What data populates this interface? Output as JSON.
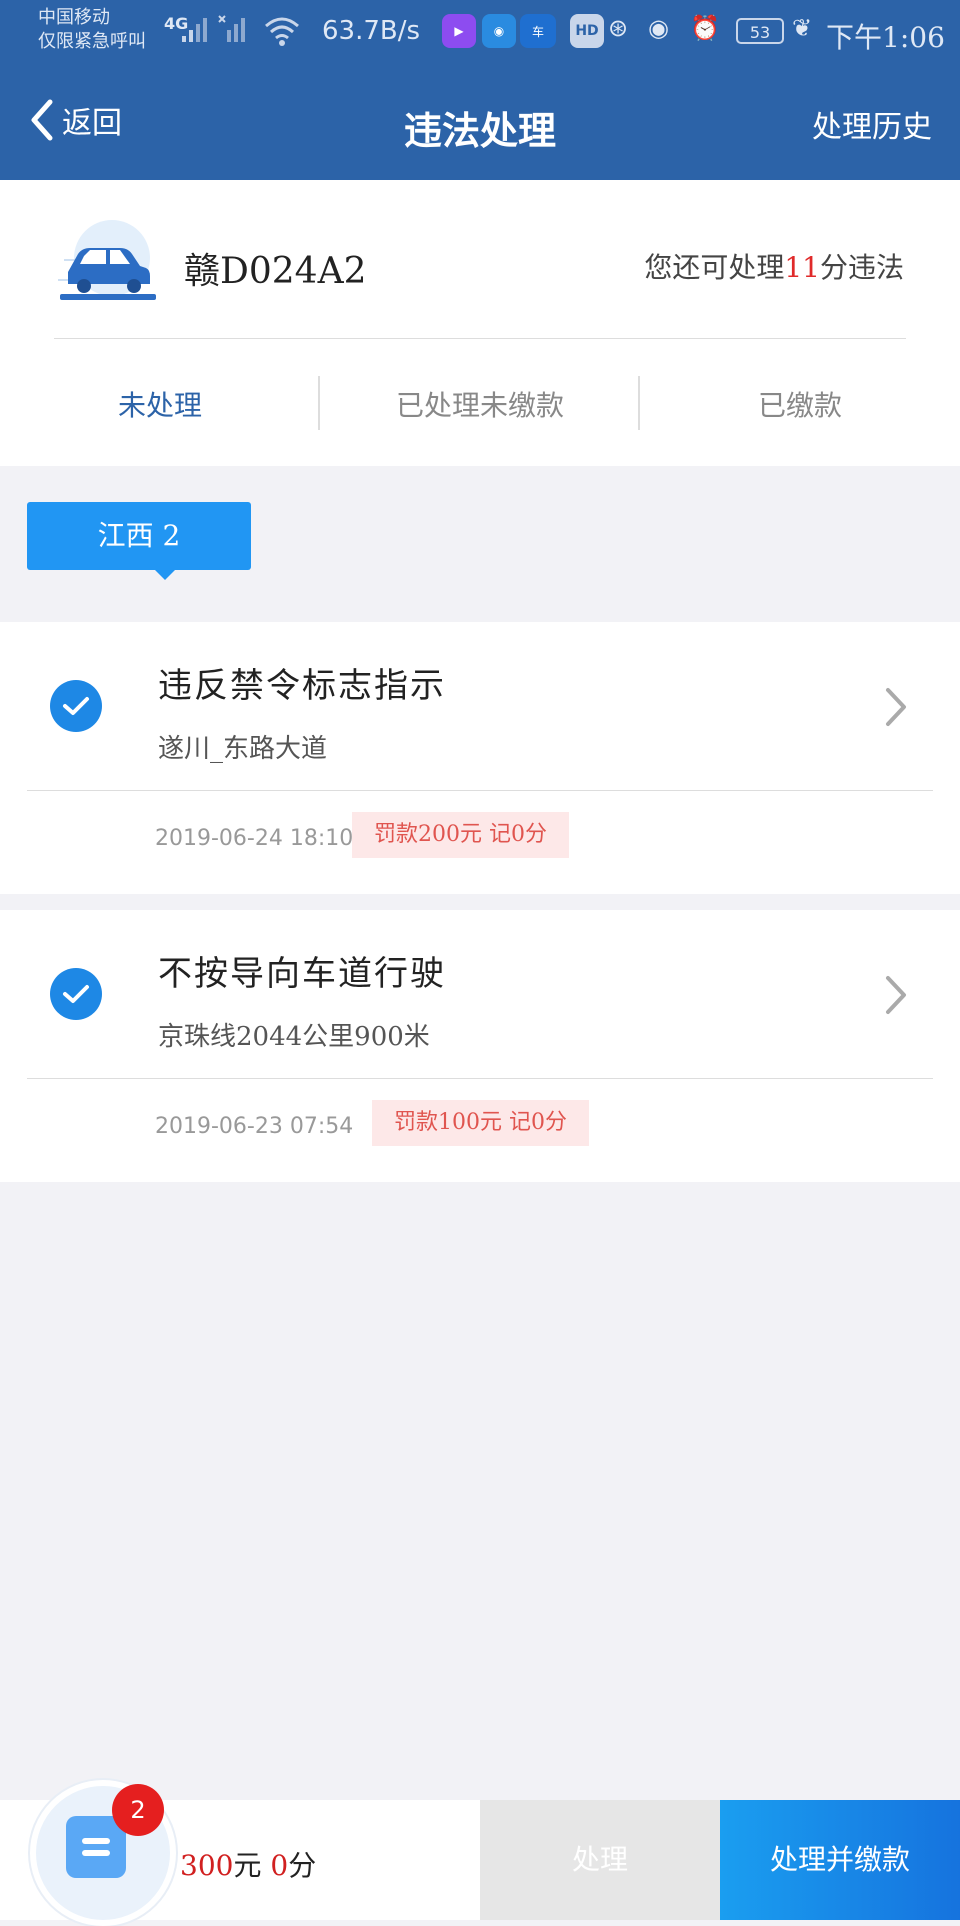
{
  "status_bar": {
    "carrier_line1": "中国移动",
    "carrier_line2": "仅限紧急呼叫",
    "network": "4G",
    "speed": "63.7B/s",
    "hd": "HD",
    "battery": "53",
    "time": "下午1:06"
  },
  "header": {
    "back_label": "返回",
    "title": "违法处理",
    "history_label": "处理历史"
  },
  "vehicle": {
    "plate": "赣D024A2",
    "remaining_prefix": "您还可处理",
    "remaining_count": "11",
    "remaining_suffix": "分违法"
  },
  "tabs": [
    {
      "label": "未处理",
      "active": true
    },
    {
      "label": "已处理未缴款",
      "active": false
    },
    {
      "label": "已缴款",
      "active": false
    }
  ],
  "region": {
    "label": "江西 2"
  },
  "violations": [
    {
      "title": "违反禁令标志指示",
      "location": "遂川_东路大道",
      "datetime": "2019-06-24 18:10",
      "fine": "罚款200元 记0分"
    },
    {
      "title": "不按导向车道行驶",
      "location": "京珠线2044公里900米",
      "datetime": "2019-06-23 07:54",
      "fine": "罚款100元 记0分"
    }
  ],
  "footer": {
    "badge_count": "2",
    "total_amount": "300",
    "total_amount_unit": "元",
    "total_points": "0",
    "total_points_unit": "分",
    "handle_label": "处理",
    "pay_label": "处理并缴款"
  },
  "colors": {
    "brand": "#2c63a8",
    "accent": "#2196f3",
    "fine_text": "#e0554f",
    "fine_bg": "#fde8e8"
  }
}
